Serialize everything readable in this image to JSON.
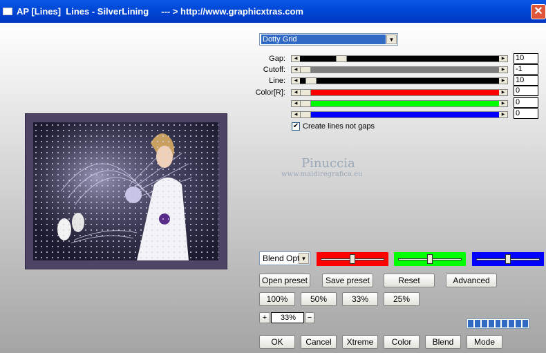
{
  "window": {
    "title": "AP [Lines]  Lines - SilverLining     --- > http://www.graphicxtras.com",
    "close_glyph": "✕"
  },
  "preset": {
    "selected": "Dotty Grid"
  },
  "sliders": [
    {
      "label": "Gap:",
      "value": "10",
      "fill": "#000000",
      "level": 0.19
    },
    {
      "label": "Cutoff:",
      "value": "-1",
      "fill": "#7e7e7e",
      "level": 0.0
    },
    {
      "label": "Line:",
      "value": "10",
      "fill": "#000000",
      "level": 0.03
    },
    {
      "label": "Color[R]:",
      "value": "0",
      "fill": "#ff0000",
      "level": 0.0
    },
    {
      "label": "",
      "value": "0",
      "fill": "#00ff00",
      "level": 0.0
    },
    {
      "label": "",
      "value": "0",
      "fill": "#0000ff",
      "level": 0.0
    }
  ],
  "create_lines": {
    "label": "Create lines not gaps",
    "checked": "✔"
  },
  "watermark": {
    "name": "Pinuccia",
    "site": "www.maidiregrafica.eu"
  },
  "blend": {
    "selected": "Blend Optio"
  },
  "color_panels": [
    {
      "color": "#ff0000",
      "level": 0.5
    },
    {
      "color": "#00ff00",
      "level": 0.5
    },
    {
      "color": "#0000ff",
      "level": 0.5
    }
  ],
  "buttons": {
    "open_preset": "Open preset",
    "save_preset": "Save preset",
    "reset": "Reset",
    "advanced": "Advanced",
    "zoom100": "100%",
    "zoom50": "50%",
    "zoom33": "33%",
    "zoom25": "25%",
    "plus": "+",
    "minus": "−",
    "zoom_value": "33%",
    "ok": "OK",
    "cancel": "Cancel",
    "xtreme": "Xtreme",
    "color": "Color",
    "blend": "Blend",
    "mode": "Mode"
  },
  "progress": {
    "segments": 9
  }
}
